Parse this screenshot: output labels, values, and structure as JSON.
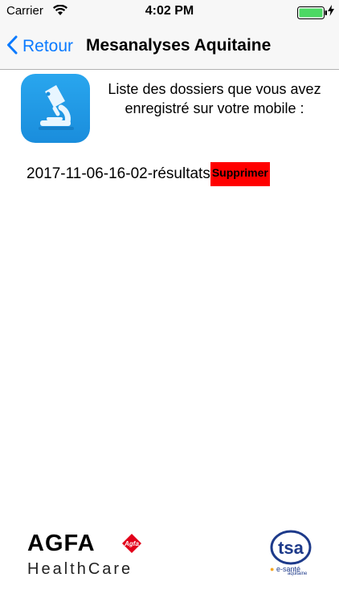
{
  "status_bar": {
    "carrier": "Carrier",
    "time": "4:02 PM"
  },
  "nav": {
    "back_label": "Retour",
    "title": "Mesanalyses Aquitaine"
  },
  "intro_text": "Liste des dossiers que vous avez enregistré sur votre mobile :",
  "files": [
    {
      "name": "2017-11-06-16-02-résultats",
      "delete_label": "Supprimer"
    }
  ],
  "footer": {
    "agfa": "AGFA",
    "agfa_small": "Agfa",
    "healthcare": "HealthCare",
    "tsa": "tsa",
    "esante": "e-santé",
    "aquitaine": "aquitaine"
  },
  "colors": {
    "accent": "#0a7aff",
    "delete": "#ff0000",
    "battery": "#4cd964",
    "icon_bg": "#1a8ddc",
    "agfa_red": "#e2001a"
  }
}
